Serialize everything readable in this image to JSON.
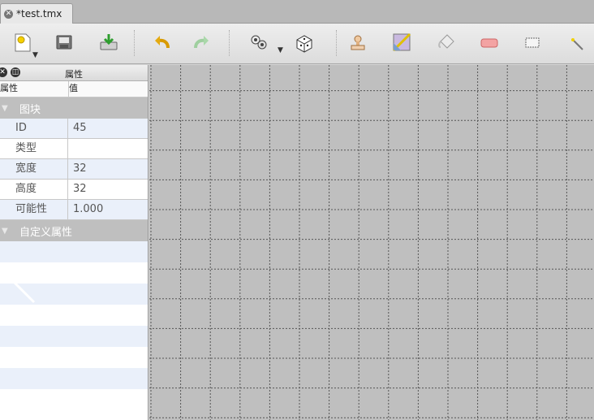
{
  "tab": {
    "title": "*test.tmx",
    "close_glyph": "✕"
  },
  "toolbar": {
    "buttons": [
      "new-icon",
      "save-icon",
      "export-icon",
      "undo-icon",
      "redo-icon",
      "random-mode-icon",
      "dice-icon",
      "stamp-icon",
      "terrain-brush-icon",
      "bucket-fill-icon",
      "eraser-icon",
      "rect-select-icon",
      "magic-wand-icon"
    ]
  },
  "properties": {
    "title": "属性",
    "col_name": "属性",
    "col_value": "值",
    "groups": [
      {
        "label": "图块",
        "rows": [
          {
            "key": "ID",
            "value": "45"
          },
          {
            "key": "类型",
            "value": ""
          },
          {
            "key": "宽度",
            "value": "32"
          },
          {
            "key": "高度",
            "value": "32"
          },
          {
            "key": "可能性",
            "value": "1.000"
          }
        ]
      },
      {
        "label": "自定义属性",
        "rows": []
      }
    ]
  },
  "colors": {
    "canvas": "#bfbfbf",
    "grid": "#555555",
    "row_alt": "#eaf0fa",
    "group": "#bfbfbf"
  }
}
